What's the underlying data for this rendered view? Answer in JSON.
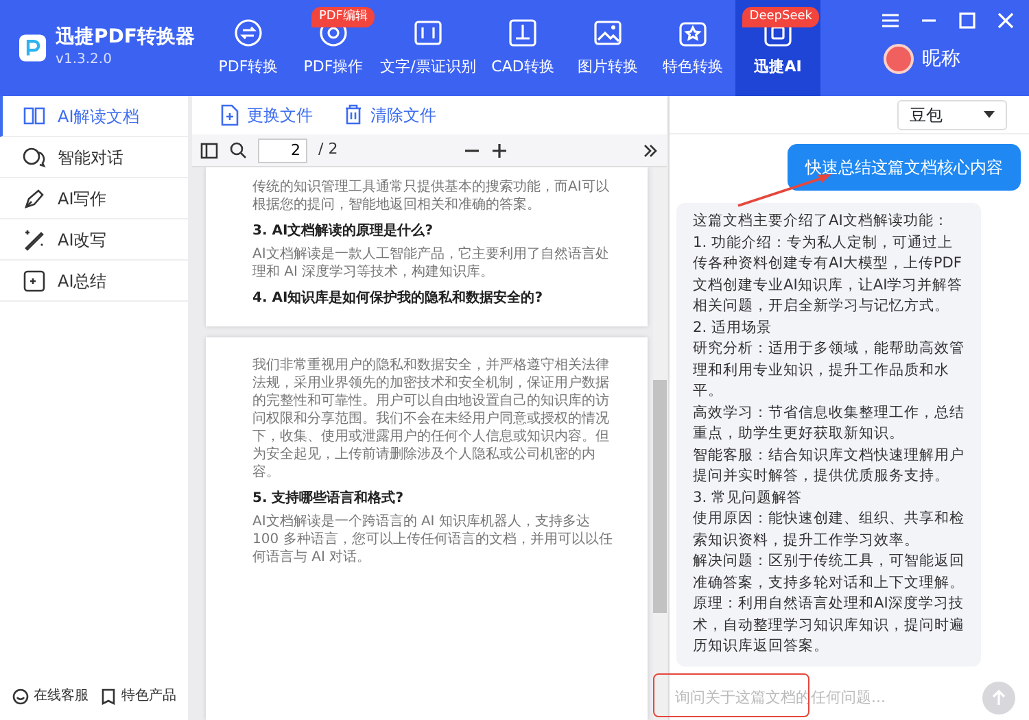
{
  "app": {
    "title": "迅捷PDF转换器",
    "version": "v1.3.2.0"
  },
  "nav_tabs": [
    {
      "label": "PDF转换",
      "selected": false
    },
    {
      "label": "PDF操作",
      "badge": "PDF编辑",
      "selected": false
    },
    {
      "label": "文字/票证识别",
      "selected": false
    },
    {
      "label": "CAD转换",
      "selected": false
    },
    {
      "label": "图片转换",
      "selected": false
    },
    {
      "label": "特色转换",
      "selected": false
    },
    {
      "label": "迅捷AI",
      "badge": "DeepSeek",
      "selected": true
    }
  ],
  "user": {
    "name": "昵称"
  },
  "sidebar": {
    "items": [
      {
        "label": "AI解读文档",
        "selected": true
      },
      {
        "label": "智能对话",
        "selected": false
      },
      {
        "label": "AI写作",
        "selected": false
      },
      {
        "label": "AI改写",
        "selected": false
      },
      {
        "label": "AI总结",
        "selected": false
      }
    ],
    "footer_links": [
      "在线客服",
      "特色产品"
    ]
  },
  "file_toolbar": {
    "buttons": [
      "更换文件",
      "清除文件"
    ]
  },
  "pdf_toolbar": {
    "page_input": "2",
    "page_total": "/ 2"
  },
  "document": {
    "pages": [
      {
        "blocks": [
          {
            "kind": "paragraph",
            "text": "传统的知识管理工具通常只提供基本的搜索功能，而AI可以根据您的提问，智能地返回相关和准确的答案。"
          },
          {
            "kind": "heading",
            "text": "3. AI文档解读的原理是什么?"
          },
          {
            "kind": "paragraph",
            "text": "AI文档解读是一款人工智能产品，它主要利用了自然语言处理和 AI 深度学习等技术，构建知识库。"
          },
          {
            "kind": "heading",
            "text": "4. AI知识库是如何保护我的隐私和数据安全的?"
          }
        ]
      },
      {
        "blocks": [
          {
            "kind": "paragraph",
            "text": "我们非常重视用户的隐私和数据安全，并严格遵守相关法律法规，采用业界领先的加密技术和安全机制，保证用户数据的完整性和可靠性。用户可以自由地设置自己的知识库的访问权限和分享范围。我们不会在未经用户同意或授权的情况下，收集、使用或泄露用户的任何个人信息或知识内容。但为安全起见，上传前请删除涉及个人隐私或公司机密的内容。"
          },
          {
            "kind": "heading",
            "text": "5. 支持哪些语言和格式?"
          },
          {
            "kind": "paragraph",
            "text": "AI文档解读是一个跨语言的 AI 知识库机器人，支持多达 100 多种语言，您可以上传任何语言的文档，并用可以以任何语言与 AI 对话。"
          }
        ]
      }
    ]
  },
  "chat": {
    "model_select": "豆包",
    "messages": [
      {
        "kind": "prompt",
        "text": "快速总结这篇文档核心内容"
      },
      {
        "kind": "answer",
        "paragraphs": [
          "这篇文档主要介绍了AI文档解读功能：",
          "1. 功能介绍：专为私人定制，可通过上传各种资料创建专有AI大模型，上传PDF文档创建专业AI知识库，让AI学习并解答相关问题，开启全新学习与记忆方式。",
          "2. 适用场景",
          "研究分析：适用于多领域，能帮助高效管理和利用专业知识，提升工作品质和水平。",
          "高效学习：节省信息收集整理工作，总结重点，助学生更好获取新知识。",
          "智能客服：结合知识库文档快速理解用户提问并实时解答，提供优质服务支持。",
          "3. 常见问题解答",
          "使用原因：能快速创建、组织、共享和检索知识资料，提升工作学习效率。",
          "解决问题：区别于传统工具，可智能返回准确答案，支持多轮对话和上下文理解。",
          "原理：利用自然语言处理和AI深度学习技术，自动整理学习知识库知识，提问时遍历知识库返回答案。"
        ]
      }
    ],
    "input": {
      "placeholder": "询问关于这篇文档的任何问题..."
    }
  }
}
